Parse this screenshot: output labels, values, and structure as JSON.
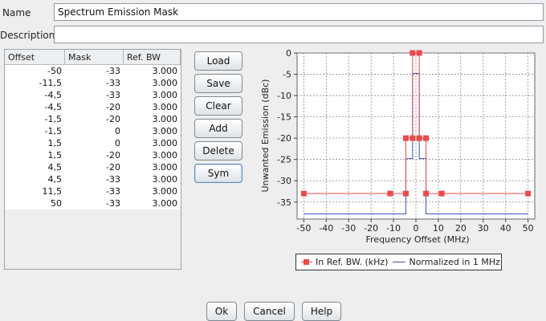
{
  "form": {
    "name_label": "Name",
    "name_value": "Spectrum Emission Mask",
    "description_label": "Description",
    "description_value": ""
  },
  "table": {
    "headers": [
      "Offset",
      "Mask",
      "Ref. BW"
    ],
    "rows": [
      [
        "-50",
        "-33",
        "3.000"
      ],
      [
        "-11,5",
        "-33",
        "3.000"
      ],
      [
        "-4,5",
        "-33",
        "3.000"
      ],
      [
        "-4,5",
        "-20",
        "3.000"
      ],
      [
        "-1,5",
        "-20",
        "3.000"
      ],
      [
        "-1,5",
        "0",
        "3.000"
      ],
      [
        "1,5",
        "0",
        "3.000"
      ],
      [
        "1,5",
        "-20",
        "3.000"
      ],
      [
        "4,5",
        "-20",
        "3.000"
      ],
      [
        "4,5",
        "-33",
        "3.000"
      ],
      [
        "11,5",
        "-33",
        "3.000"
      ],
      [
        "50",
        "-33",
        "3.000"
      ]
    ]
  },
  "buttons": {
    "load": "Load",
    "save": "Save",
    "clear": "Clear",
    "add": "Add",
    "delete": "Delete",
    "sym": "Sym"
  },
  "dialog": {
    "ok": "Ok",
    "cancel": "Cancel",
    "help": "Help"
  },
  "colors": {
    "mask_series": "#e84b4b",
    "normalized_series": "#4050b8",
    "grid": "#888888"
  },
  "chart_data": {
    "type": "line",
    "xlabel": "Frequency Offset (MHz)",
    "ylabel": "Unwanted Emission (dBc)",
    "xlim": [
      -53,
      53
    ],
    "ylim": [
      -39,
      0
    ],
    "xticks": [
      -50,
      -40,
      -30,
      -20,
      -10,
      0,
      10,
      20,
      30,
      40,
      50
    ],
    "yticks": [
      0,
      -5,
      -10,
      -15,
      -20,
      -25,
      -30,
      -35
    ],
    "xtick_labels": [
      "-50",
      "-40",
      "-30",
      "-20",
      "-10",
      "0",
      "10",
      "20",
      "30",
      "40",
      "50"
    ],
    "ytick_labels": [
      "0",
      "-5",
      "-10",
      "-15",
      "-20",
      "-25",
      "-30",
      "-35"
    ],
    "grid": true,
    "legend_position": "bottom",
    "series": [
      {
        "name": "In Ref. BW. (kHz)",
        "markers": true,
        "x": [
          -50,
          -11.5,
          -4.5,
          -4.5,
          -1.5,
          -1.5,
          1.5,
          1.5,
          4.5,
          4.5,
          11.5,
          50
        ],
        "y": [
          -33,
          -33,
          -33,
          -20,
          -20,
          0,
          0,
          -20,
          -20,
          -33,
          -33,
          -33
        ]
      },
      {
        "name": "Normalized in 1 MHz",
        "markers": false,
        "x": [
          -50,
          -4.5,
          -4.5,
          -1.5,
          -1.5,
          1.5,
          1.5,
          4.5,
          4.5,
          50
        ],
        "y": [
          -37.8,
          -37.8,
          -24.8,
          -24.8,
          -4.8,
          -4.8,
          -24.8,
          -24.8,
          -37.8,
          -37.8
        ]
      }
    ]
  }
}
